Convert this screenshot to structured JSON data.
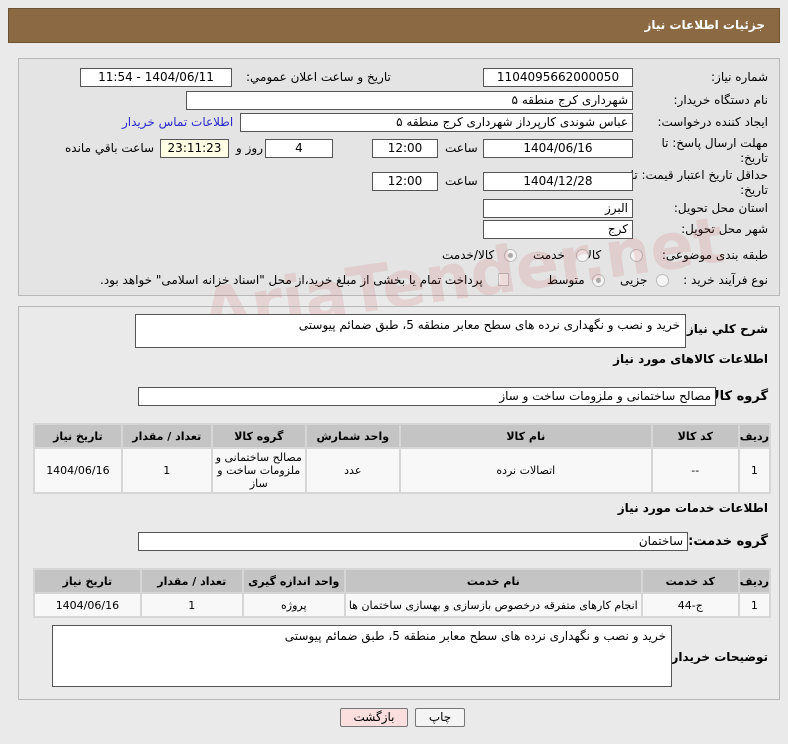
{
  "header": {
    "title": "جزئیات اطلاعات نیاز"
  },
  "form": {
    "need_number_label": "شماره نیاز:",
    "need_number": "1104095662000050",
    "announce_label": "تاریخ و ساعت اعلان عمومي:",
    "announce_value": "1404/06/11 - 11:54",
    "buyer_label": "نام دستگاه خریدار:",
    "buyer_value": "شهرداری کرج منطقه ۵",
    "creator_label": "ایجاد کننده درخواست:",
    "creator_value": "عباس شوندی کارپرداز شهرداری کرج منطقه ۵",
    "contact_link": "اطلاعات تماس خریدار",
    "deadline_label": "مهلت ارسال پاسخ: تا تاریخ:",
    "deadline_date": "1404/06/16",
    "time_label": "ساعت",
    "deadline_time": "12:00",
    "days": "4",
    "days_label": "روز و",
    "remaining": "23:11:23",
    "remaining_label": "ساعت باقي مانده",
    "validity_label": "حداقل تاریخ اعتبار قیمت: تا تاریخ:",
    "validity_date": "1404/12/28",
    "validity_time": "12:00",
    "province_label": "استان محل تحویل:",
    "province": "البرز",
    "city_label": "شهر محل تحویل:",
    "city": "کرج",
    "category_label": "طبقه بندی موضوعی:",
    "category_options": [
      "کالا",
      "خدمت",
      "کالا/خدمت"
    ],
    "category_selected": "کالا/خدمت",
    "process_label": "نوع فرآیند خرید :",
    "process_options": [
      "جزیی",
      "متوسط"
    ],
    "process_selected": "متوسط",
    "payment_note": "پرداخت تمام یا بخشی از مبلغ خرید،از محل \"اسناد خزانه اسلامی\" خواهد بود."
  },
  "details": {
    "desc_label": "شرح کلي نياز:",
    "desc": "خرید و نصب و نگهداری نرده های سطح معابر منطقه 5، طبق ضمائم پیوستی",
    "goods_heading": "اطلاعات کالاهای مورد نیاز",
    "goods_group_label": "گروه کالا:",
    "goods_group": "مصالح ساختمانی و ملزومات ساخت و ساز",
    "goods_columns": [
      "ردیف",
      "کد کالا",
      "نام کالا",
      "واحد شمارش",
      "گروه کالا",
      "تعداد / مقدار",
      "تاریخ نیاز"
    ],
    "goods_rows": [
      [
        "1",
        "--",
        "اتصالات نرده",
        "عدد",
        "مصالح ساختمانی و ملزومات ساخت و ساز",
        "1",
        "1404/06/16"
      ]
    ],
    "services_heading": "اطلاعات خدمات مورد نیاز",
    "service_group_label": "گروه خدمت:",
    "service_group": "ساختمان",
    "service_columns": [
      "ردیف",
      "کد خدمت",
      "نام خدمت",
      "واحد اندازه گیری",
      "تعداد / مقدار",
      "تاریخ نیاز"
    ],
    "service_rows": [
      [
        "1",
        "ج-44",
        "انجام کارهای متفرقه درخصوص بازسازی و بهسازی ساختمان ها",
        "پروژه",
        "1",
        "1404/06/16"
      ]
    ],
    "buyer_notes_label": "توضیحات خریدار:",
    "buyer_notes": "خرید و نصب و نگهداری نرده های سطح معابر منطقه 5، طبق ضمائم پیوستی"
  },
  "buttons": {
    "print": "چاپ",
    "back": "بازگشت"
  },
  "watermark": "AriaTender.net"
}
